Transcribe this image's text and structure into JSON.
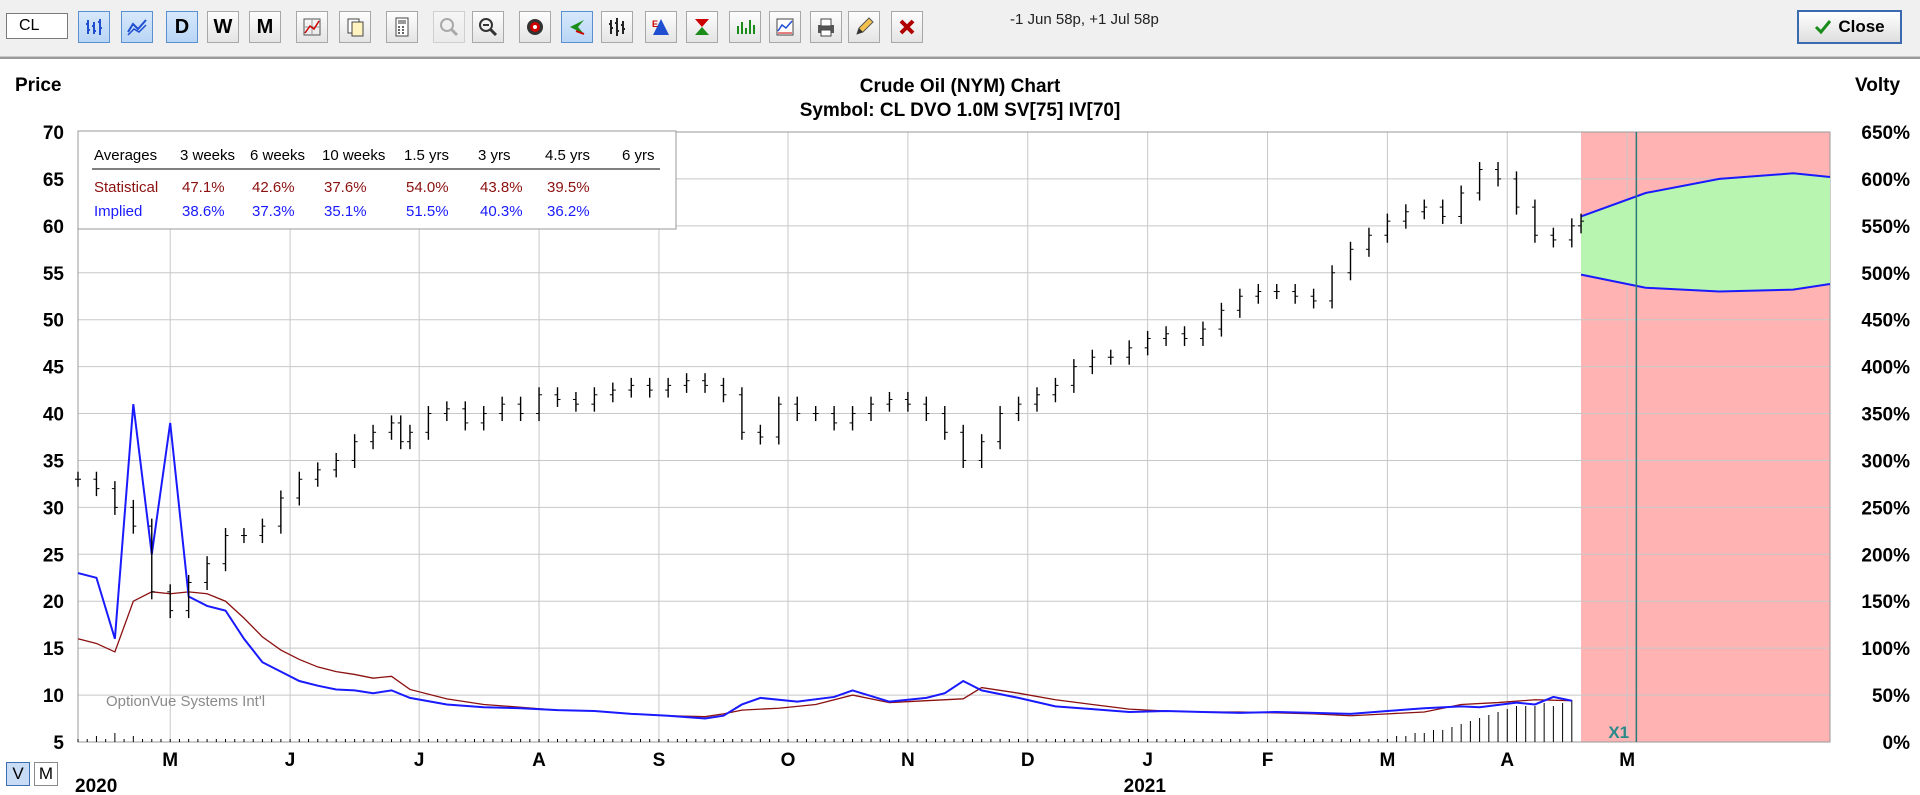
{
  "toolbar": {
    "symbol": "CL",
    "period_buttons": [
      "D",
      "W",
      "M"
    ],
    "status": "-1 Jun 58p, +1 Jul 58p",
    "close_label": "Close"
  },
  "view_modes": [
    "V",
    "M"
  ],
  "chart_data": {
    "type": "line",
    "title": "Crude Oil (NYM) Chart",
    "subtitle": "Symbol: CL  DVO 1.0M  SV[75]  IV[70]",
    "y_left_label": "Price",
    "y_right_label": "Volty",
    "y_left_ticks": [
      70,
      65,
      60,
      55,
      50,
      45,
      40,
      35,
      30,
      25,
      20,
      15,
      10,
      5
    ],
    "y_left_range": [
      5,
      70
    ],
    "y_right_ticks": [
      "650%",
      "600%",
      "550%",
      "500%",
      "450%",
      "400%",
      "350%",
      "300%",
      "250%",
      "200%",
      "150%",
      "100%",
      "50%",
      "0%"
    ],
    "y_right_range": [
      0,
      650
    ],
    "x_month_labels": [
      "M",
      "J",
      "J",
      "A",
      "S",
      "O",
      "N",
      "D",
      "J",
      "F",
      "M",
      "A",
      "M"
    ],
    "year_labels": [
      "2020",
      "2021"
    ],
    "watermark": "OptionVue Systems Int'l",
    "expiry_marker": "X1",
    "grid": true,
    "colors": {
      "price": "#000000",
      "implied": "#1a1aff",
      "statistical": "#8b1010",
      "forecast_bg": "#ffb3b3",
      "cone_fill": "#b8f5b0",
      "volume": "#000000"
    },
    "averages_table": {
      "headers": [
        "Averages",
        "3 weeks",
        "6 weeks",
        "10 weeks",
        "1.5 yrs",
        "3 yrs",
        "4.5 yrs",
        "6 yrs"
      ],
      "rows": [
        {
          "label": "Statistical",
          "values": [
            "47.1%",
            "42.6%",
            "37.6%",
            "54.0%",
            "43.8%",
            "39.5%",
            ""
          ]
        },
        {
          "label": "Implied",
          "values": [
            "38.6%",
            "37.3%",
            "35.1%",
            "51.5%",
            "40.3%",
            "36.2%",
            ""
          ]
        }
      ]
    },
    "series": [
      {
        "name": "Price",
        "unit": "price",
        "points": [
          [
            0,
            33
          ],
          [
            2,
            32
          ],
          [
            4,
            30
          ],
          [
            6,
            28
          ],
          [
            8,
            21
          ],
          [
            10,
            19
          ],
          [
            12,
            22
          ],
          [
            14,
            24
          ],
          [
            16,
            27
          ],
          [
            18,
            27
          ],
          [
            20,
            28
          ],
          [
            22,
            31
          ],
          [
            24,
            33
          ],
          [
            26,
            34
          ],
          [
            28,
            35
          ],
          [
            30,
            37
          ],
          [
            32,
            38
          ],
          [
            34,
            39
          ],
          [
            35,
            37
          ],
          [
            36,
            38
          ],
          [
            38,
            40
          ],
          [
            40,
            40.5
          ],
          [
            42,
            39
          ],
          [
            44,
            40
          ],
          [
            46,
            41
          ],
          [
            48,
            40
          ],
          [
            50,
            42
          ],
          [
            52,
            41.5
          ],
          [
            54,
            41
          ],
          [
            56,
            42
          ],
          [
            58,
            42.5
          ],
          [
            60,
            43
          ],
          [
            62,
            42.5
          ],
          [
            64,
            43
          ],
          [
            66,
            43.5
          ],
          [
            68,
            43
          ],
          [
            70,
            42
          ],
          [
            72,
            38
          ],
          [
            74,
            37.5
          ],
          [
            76,
            41
          ],
          [
            78,
            40
          ],
          [
            80,
            40
          ],
          [
            82,
            39
          ],
          [
            84,
            40
          ],
          [
            86,
            41
          ],
          [
            88,
            41.5
          ],
          [
            90,
            41
          ],
          [
            92,
            40
          ],
          [
            94,
            38
          ],
          [
            96,
            35
          ],
          [
            98,
            37
          ],
          [
            100,
            40
          ],
          [
            102,
            41
          ],
          [
            104,
            42
          ],
          [
            106,
            43
          ],
          [
            108,
            45
          ],
          [
            110,
            46
          ],
          [
            112,
            46
          ],
          [
            114,
            47
          ],
          [
            116,
            48
          ],
          [
            118,
            48.5
          ],
          [
            120,
            48
          ],
          [
            122,
            49
          ],
          [
            124,
            51
          ],
          [
            126,
            52.5
          ],
          [
            128,
            53
          ],
          [
            130,
            53
          ],
          [
            132,
            52.5
          ],
          [
            134,
            52
          ],
          [
            136,
            55
          ],
          [
            138,
            57.5
          ],
          [
            140,
            59
          ],
          [
            142,
            60.5
          ],
          [
            144,
            61.5
          ],
          [
            146,
            62
          ],
          [
            148,
            61
          ],
          [
            150,
            63.5
          ],
          [
            152,
            66
          ],
          [
            154,
            65
          ],
          [
            156,
            62
          ],
          [
            158,
            59
          ],
          [
            160,
            58.5
          ],
          [
            162,
            60
          ],
          [
            163,
            60.5
          ]
        ]
      },
      {
        "name": "Implied",
        "unit": "percent",
        "points": [
          [
            0,
            180
          ],
          [
            2,
            175
          ],
          [
            4,
            110
          ],
          [
            6,
            360
          ],
          [
            8,
            200
          ],
          [
            10,
            340
          ],
          [
            12,
            155
          ],
          [
            14,
            145
          ],
          [
            16,
            140
          ],
          [
            18,
            110
          ],
          [
            20,
            85
          ],
          [
            22,
            75
          ],
          [
            24,
            65
          ],
          [
            26,
            60
          ],
          [
            28,
            56
          ],
          [
            30,
            55
          ],
          [
            32,
            52
          ],
          [
            34,
            55
          ],
          [
            36,
            47
          ],
          [
            40,
            40
          ],
          [
            44,
            37
          ],
          [
            48,
            36
          ],
          [
            52,
            34
          ],
          [
            56,
            33
          ],
          [
            60,
            30
          ],
          [
            64,
            28
          ],
          [
            68,
            25
          ],
          [
            70,
            28
          ],
          [
            72,
            40
          ],
          [
            74,
            47
          ],
          [
            78,
            43
          ],
          [
            82,
            48
          ],
          [
            84,
            55
          ],
          [
            88,
            43
          ],
          [
            92,
            47
          ],
          [
            94,
            52
          ],
          [
            96,
            65
          ],
          [
            98,
            55
          ],
          [
            102,
            47
          ],
          [
            106,
            38
          ],
          [
            110,
            35
          ],
          [
            114,
            32
          ],
          [
            118,
            33
          ],
          [
            122,
            32
          ],
          [
            126,
            31
          ],
          [
            130,
            32
          ],
          [
            134,
            31
          ],
          [
            138,
            30
          ],
          [
            142,
            33
          ],
          [
            146,
            36
          ],
          [
            150,
            38
          ],
          [
            152,
            37
          ],
          [
            156,
            42
          ],
          [
            158,
            40
          ],
          [
            160,
            48
          ],
          [
            162,
            44
          ]
        ]
      },
      {
        "name": "Statistical",
        "unit": "percent",
        "points": [
          [
            0,
            110
          ],
          [
            2,
            105
          ],
          [
            4,
            96
          ],
          [
            6,
            150
          ],
          [
            8,
            160
          ],
          [
            10,
            158
          ],
          [
            12,
            160
          ],
          [
            14,
            158
          ],
          [
            16,
            150
          ],
          [
            18,
            132
          ],
          [
            20,
            112
          ],
          [
            22,
            98
          ],
          [
            24,
            88
          ],
          [
            26,
            80
          ],
          [
            28,
            75
          ],
          [
            30,
            72
          ],
          [
            32,
            68
          ],
          [
            34,
            70
          ],
          [
            36,
            56
          ],
          [
            40,
            46
          ],
          [
            44,
            40
          ],
          [
            48,
            37
          ],
          [
            52,
            34
          ],
          [
            56,
            33
          ],
          [
            60,
            30
          ],
          [
            64,
            28
          ],
          [
            68,
            27
          ],
          [
            70,
            30
          ],
          [
            72,
            34
          ],
          [
            76,
            36
          ],
          [
            80,
            40
          ],
          [
            84,
            50
          ],
          [
            88,
            42
          ],
          [
            92,
            44
          ],
          [
            96,
            46
          ],
          [
            98,
            58
          ],
          [
            102,
            52
          ],
          [
            106,
            45
          ],
          [
            110,
            40
          ],
          [
            114,
            35
          ],
          [
            118,
            33
          ],
          [
            122,
            32
          ],
          [
            126,
            32
          ],
          [
            130,
            31
          ],
          [
            134,
            30
          ],
          [
            138,
            28
          ],
          [
            142,
            30
          ],
          [
            146,
            32
          ],
          [
            150,
            40
          ],
          [
            154,
            42
          ],
          [
            158,
            45
          ],
          [
            162,
            44
          ]
        ]
      },
      {
        "name": "Cone upper",
        "unit": "percent",
        "points": [
          [
            163,
            560
          ],
          [
            170,
            585
          ],
          [
            178,
            600
          ],
          [
            186,
            606
          ],
          [
            190,
            602
          ]
        ]
      },
      {
        "name": "Cone lower",
        "unit": "percent",
        "points": [
          [
            163,
            498
          ],
          [
            170,
            484
          ],
          [
            178,
            480
          ],
          [
            186,
            482
          ],
          [
            190,
            488
          ]
        ]
      }
    ],
    "volume": [
      1,
      1,
      2,
      1,
      3,
      1,
      2,
      1,
      1,
      1,
      1,
      1,
      1,
      1,
      1,
      1,
      1,
      1,
      1,
      1,
      1,
      1,
      1,
      1,
      1,
      1,
      1,
      1,
      1,
      1,
      1,
      1,
      1,
      1,
      1,
      1,
      1,
      1,
      1,
      1,
      1,
      1,
      1,
      1,
      1,
      1,
      1,
      1,
      1,
      1,
      1,
      1,
      1,
      1,
      1,
      1,
      1,
      1,
      1,
      1,
      1,
      1,
      1,
      1,
      1,
      1,
      1,
      1,
      1,
      1,
      1,
      1,
      1,
      1,
      1,
      1,
      1,
      1,
      1,
      1,
      1,
      1,
      1,
      1,
      1,
      1,
      1,
      1,
      1,
      1,
      1,
      1,
      1,
      1,
      1,
      1,
      1,
      1,
      1,
      1,
      1,
      1,
      1,
      1,
      1,
      1,
      1,
      1,
      1,
      1,
      1,
      1,
      1,
      1,
      1,
      1,
      1,
      1,
      1,
      1,
      1,
      1,
      1,
      1,
      1,
      1,
      1,
      1,
      1,
      1,
      1,
      1,
      1,
      1,
      1,
      1,
      1,
      1,
      1,
      1,
      1,
      1,
      1,
      2,
      2,
      3,
      3,
      4,
      4,
      5,
      6,
      7,
      8,
      9,
      10,
      11,
      12,
      12,
      12,
      13,
      12,
      13,
      14
    ]
  }
}
